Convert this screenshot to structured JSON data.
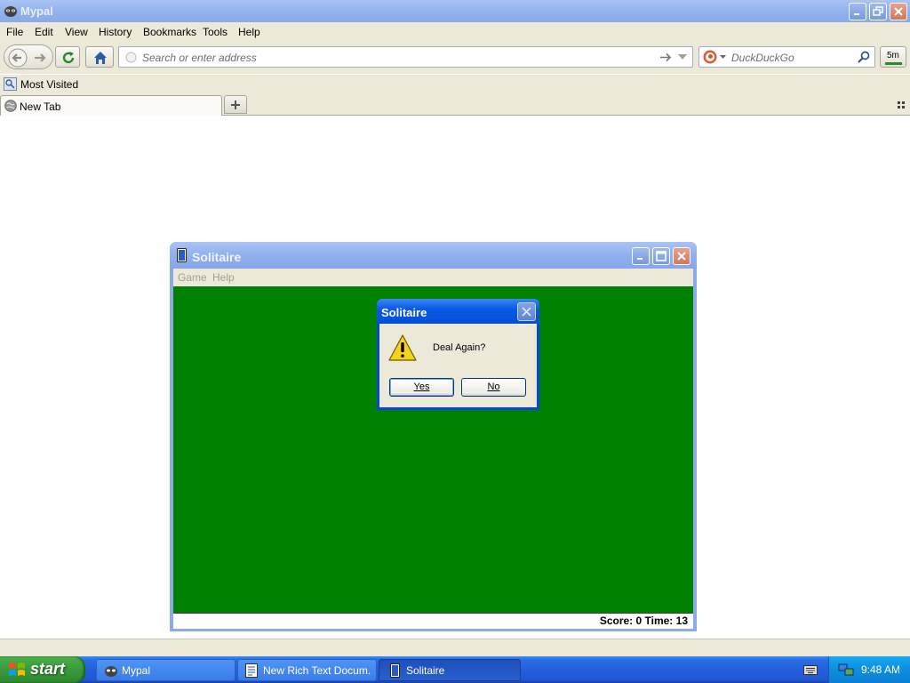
{
  "browser": {
    "title": "Mypal",
    "menu": [
      "File",
      "Edit",
      "View",
      "History",
      "Bookmarks",
      "Tools",
      "Help"
    ],
    "address_placeholder": "Search or enter address",
    "search_placeholder": "DuckDuckGo",
    "addon_badge": "5m",
    "bookmarks_label": "Most Visited",
    "tab_label": "New Tab"
  },
  "solitaire": {
    "title": "Solitaire",
    "menu": [
      "Game",
      "Help"
    ],
    "status": "Score: 0 Time: 13"
  },
  "dialog": {
    "title": "Solitaire",
    "message": "Deal Again?",
    "yes_label": "Yes",
    "no_label": "No"
  },
  "taskbar": {
    "start_label": "start",
    "items": [
      {
        "label": "Mypal",
        "icon": "mypal-icon"
      },
      {
        "label": "New Rich Text Docum...",
        "icon": "document-icon"
      },
      {
        "label": "Solitaire",
        "icon": "solitaire-icon"
      }
    ],
    "clock": "9:48 AM"
  },
  "colors": {
    "felt": "#008000",
    "xp_blue": "#245edb",
    "start_green": "#3c9a3c",
    "chrome": "#ece9d8"
  }
}
